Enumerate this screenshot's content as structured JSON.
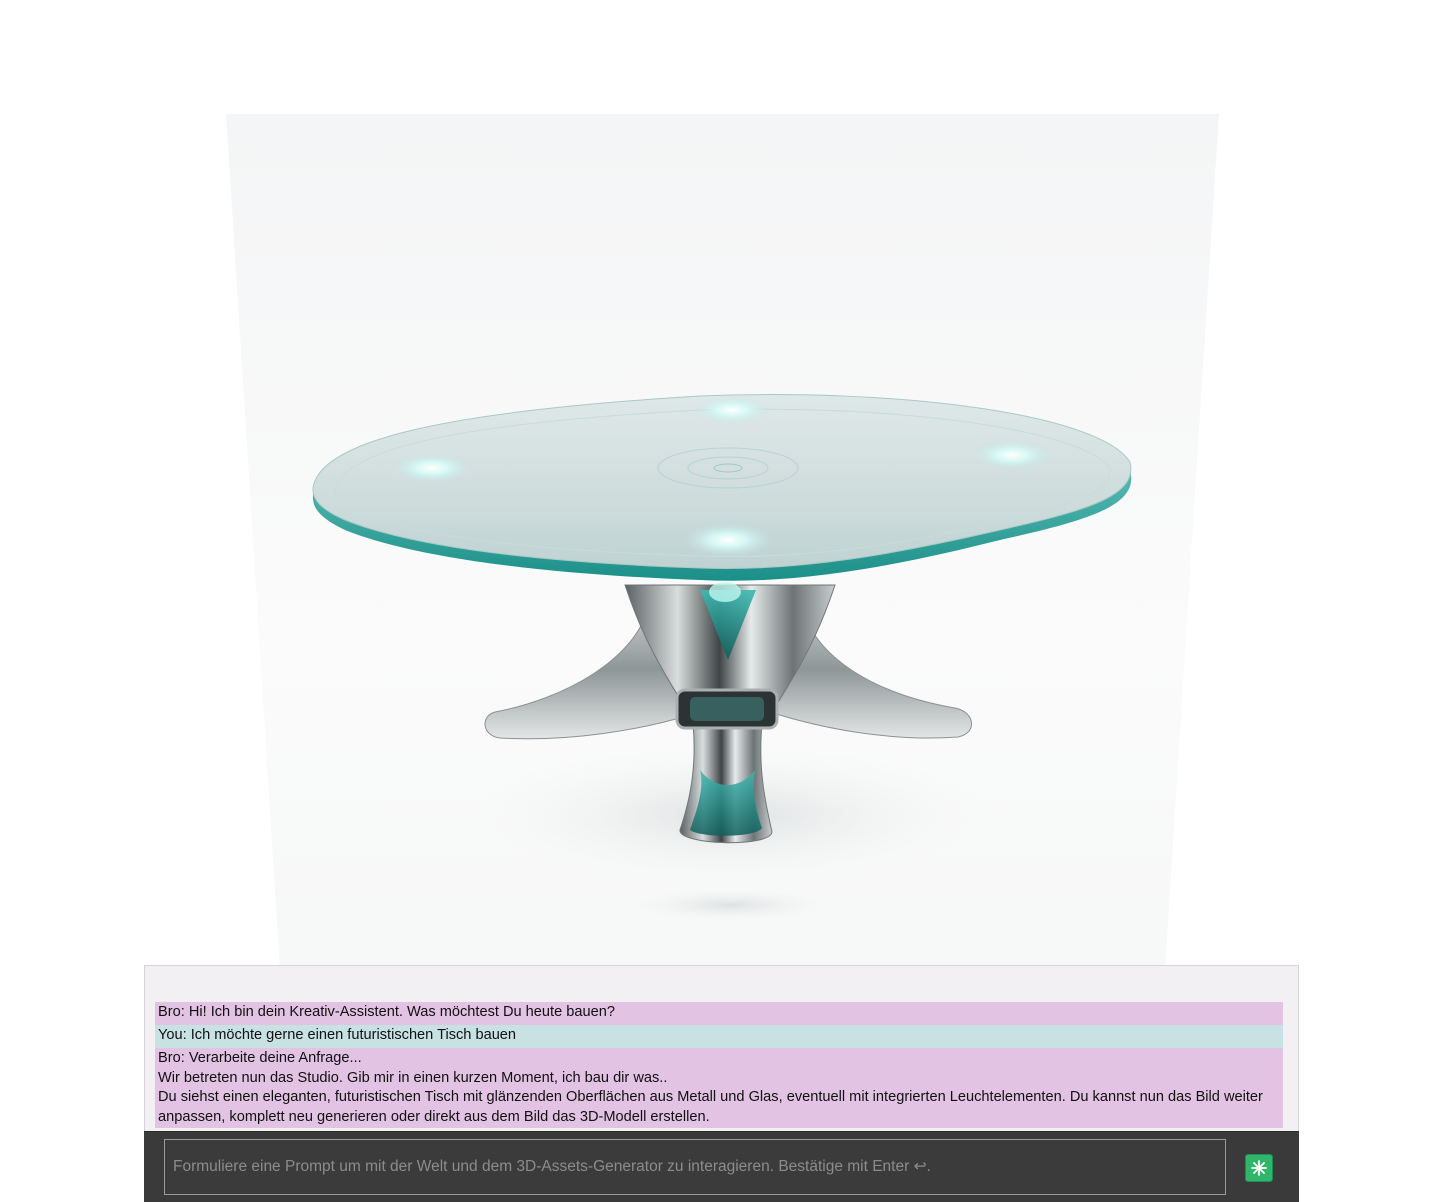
{
  "render": {
    "subject": "futuristic table",
    "accent": "#4fd0c8"
  },
  "chat": {
    "messages": [
      {
        "role": "bot",
        "lines": [
          "Bro: Hi! Ich bin dein Kreativ-Assistent. Was möchtest Du heute bauen?"
        ]
      },
      {
        "role": "user",
        "lines": [
          "You: Ich möchte gerne einen futuristischen Tisch bauen"
        ]
      },
      {
        "role": "bot",
        "lines": [
          "Bro: Verarbeite deine Anfrage...",
          "Wir betreten nun das Studio. Gib mir in einen kurzen Moment, ich bau dir was..",
          "Du siehst einen eleganten, futuristischen Tisch mit glänzenden Oberflächen aus Metall und Glas, eventuell mit integrierten Leuchtelementen. Du kannst nun das Bild weiter anpassen, komplett neu generieren oder direkt aus dem Bild das 3D-Modell erstellen."
        ]
      }
    ]
  },
  "input": {
    "placeholder": "Formuliere eine Prompt um mit der Welt und dem 3D-Assets-Generator zu interagieren. Bestätige mit Enter ↩.",
    "value": ""
  },
  "send_button": {
    "icon": "sparkle-icon",
    "color": "#2fb66a"
  },
  "colors": {
    "bot_bubble": "#e2c3e3",
    "user_bubble": "#c8e2e4",
    "input_bar": "#3a3a3a"
  }
}
